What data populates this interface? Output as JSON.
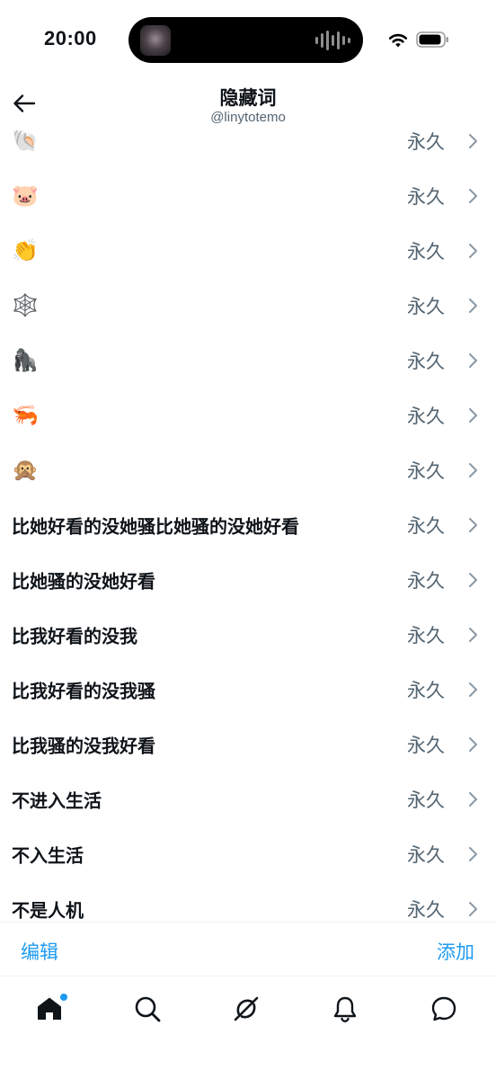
{
  "status_bar": {
    "time": "20:00"
  },
  "header": {
    "title": "隐藏词",
    "subtitle": "@linytotemo",
    "back_icon": "arrow-left-icon"
  },
  "list": {
    "items": [
      {
        "label": "🐚",
        "emoji": true,
        "duration": "永久"
      },
      {
        "label": "🐷",
        "emoji": true,
        "duration": "永久"
      },
      {
        "label": "👏",
        "emoji": true,
        "duration": "永久"
      },
      {
        "label": "🕸️",
        "emoji": true,
        "duration": "永久"
      },
      {
        "label": "🦍",
        "emoji": true,
        "duration": "永久"
      },
      {
        "label": "🦐",
        "emoji": true,
        "duration": "永久"
      },
      {
        "label": "🙊",
        "emoji": true,
        "duration": "永久"
      },
      {
        "label": "比她好看的没她骚比她骚的没她好看",
        "emoji": false,
        "duration": "永久"
      },
      {
        "label": "比她骚的没她好看",
        "emoji": false,
        "duration": "永久"
      },
      {
        "label": "比我好看的没我",
        "emoji": false,
        "duration": "永久"
      },
      {
        "label": "比我好看的没我骚",
        "emoji": false,
        "duration": "永久"
      },
      {
        "label": "比我骚的没我好看",
        "emoji": false,
        "duration": "永久"
      },
      {
        "label": "不进入生活",
        "emoji": false,
        "duration": "永久"
      },
      {
        "label": "不入生活",
        "emoji": false,
        "duration": "永久"
      },
      {
        "label": "不是人机",
        "emoji": false,
        "duration": "永久"
      }
    ]
  },
  "actions": {
    "edit_label": "编辑",
    "add_label": "添加"
  },
  "tabs": [
    {
      "name": "home",
      "icon": "home-icon",
      "active": true,
      "badge": true
    },
    {
      "name": "search",
      "icon": "search-icon",
      "active": false
    },
    {
      "name": "grok",
      "icon": "grok-icon",
      "active": false
    },
    {
      "name": "notifications",
      "icon": "bell-icon",
      "active": false
    },
    {
      "name": "messages",
      "icon": "message-icon",
      "active": false
    }
  ],
  "colors": {
    "accent": "#1d9bf0",
    "text": "#0f1419",
    "secondary": "#536471",
    "chevron": "#8b98a5"
  }
}
